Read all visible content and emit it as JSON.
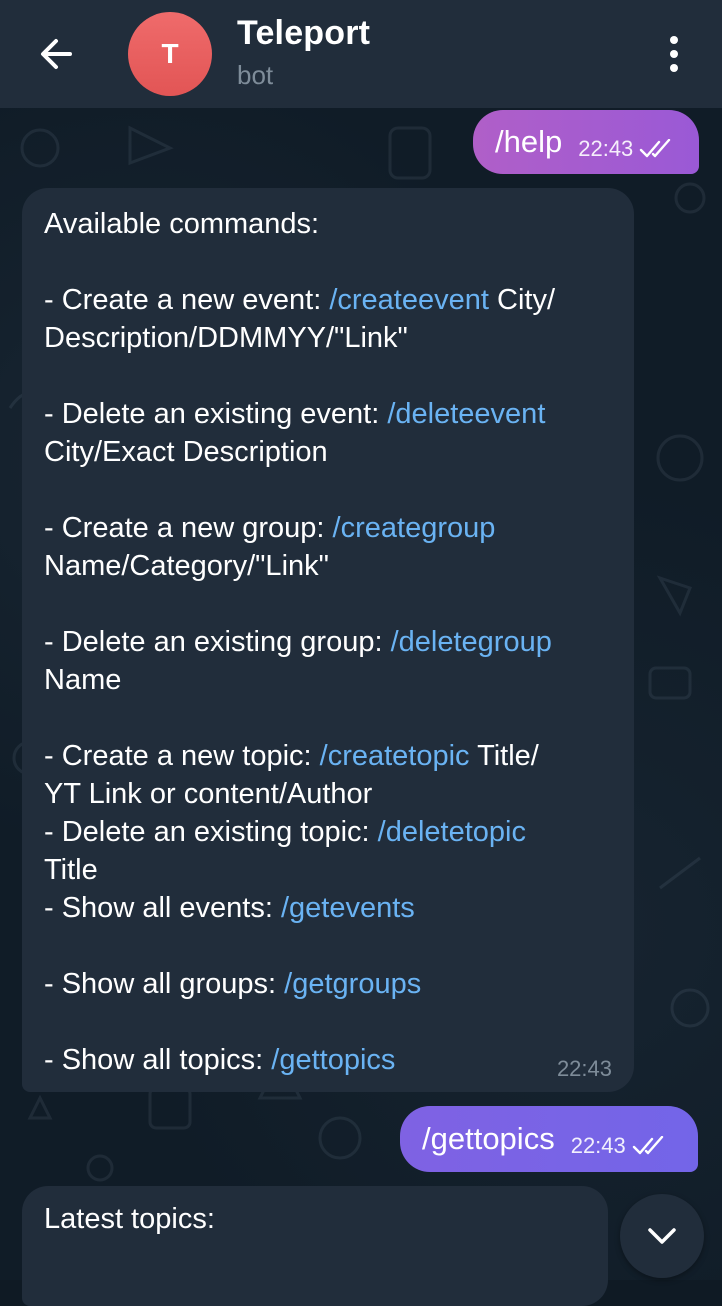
{
  "header": {
    "title": "Teleport",
    "subtitle": "bot",
    "avatar_letter": "T",
    "avatar_color": "#e25555"
  },
  "messages": {
    "help": {
      "text": "/help",
      "time": "22:43"
    },
    "commands": {
      "time": "22:43",
      "lines": [
        [
          {
            "t": "Available commands:"
          }
        ],
        [],
        [
          {
            "t": "- Create a new event: "
          },
          {
            "t": "/createevent",
            "cmd": true
          },
          {
            "t": " City/"
          }
        ],
        [
          {
            "t": "Description/DDMMYY/\"Link\""
          }
        ],
        [],
        [
          {
            "t": "- Delete an existing event: "
          },
          {
            "t": "/deleteevent",
            "cmd": true
          }
        ],
        [
          {
            "t": "City/Exact Description"
          }
        ],
        [],
        [
          {
            "t": "- Create a new group: "
          },
          {
            "t": "/creategroup",
            "cmd": true
          }
        ],
        [
          {
            "t": "Name/Category/\"Link\""
          }
        ],
        [],
        [
          {
            "t": "- Delete an existing group: "
          },
          {
            "t": "/deletegroup",
            "cmd": true
          }
        ],
        [
          {
            "t": "Name"
          }
        ],
        [],
        [
          {
            "t": "- Create a new topic: "
          },
          {
            "t": "/createtopic",
            "cmd": true
          },
          {
            "t": " Title/"
          }
        ],
        [
          {
            "t": "YT Link or content/Author"
          }
        ],
        [
          {
            "t": "- Delete an existing topic: "
          },
          {
            "t": "/deletetopic",
            "cmd": true
          }
        ],
        [
          {
            "t": "Title"
          }
        ],
        [
          {
            "t": "- Show all events: "
          },
          {
            "t": "/getevents",
            "cmd": true
          }
        ],
        [],
        [
          {
            "t": "- Show all groups: "
          },
          {
            "t": "/getgroups",
            "cmd": true
          }
        ],
        [],
        [
          {
            "t": "- Show all topics: "
          },
          {
            "t": "/gettopics",
            "cmd": true
          }
        ]
      ]
    },
    "gettopics": {
      "text": "/gettopics",
      "time": "22:43"
    },
    "latest": {
      "text": "Latest topics:"
    }
  },
  "colors": {
    "header_bg": "#212d3b",
    "incoming_bubble": "#212d3b",
    "link": "#6ab3f3",
    "outgoing_help": "#b05fc8",
    "outgoing_gettopics": "#7365e8",
    "muted": "#7e8c99"
  },
  "icons": {
    "back": "arrow-left-icon",
    "menu": "more-vertical-icon",
    "read": "double-check-icon",
    "scroll": "chevron-down-icon"
  }
}
